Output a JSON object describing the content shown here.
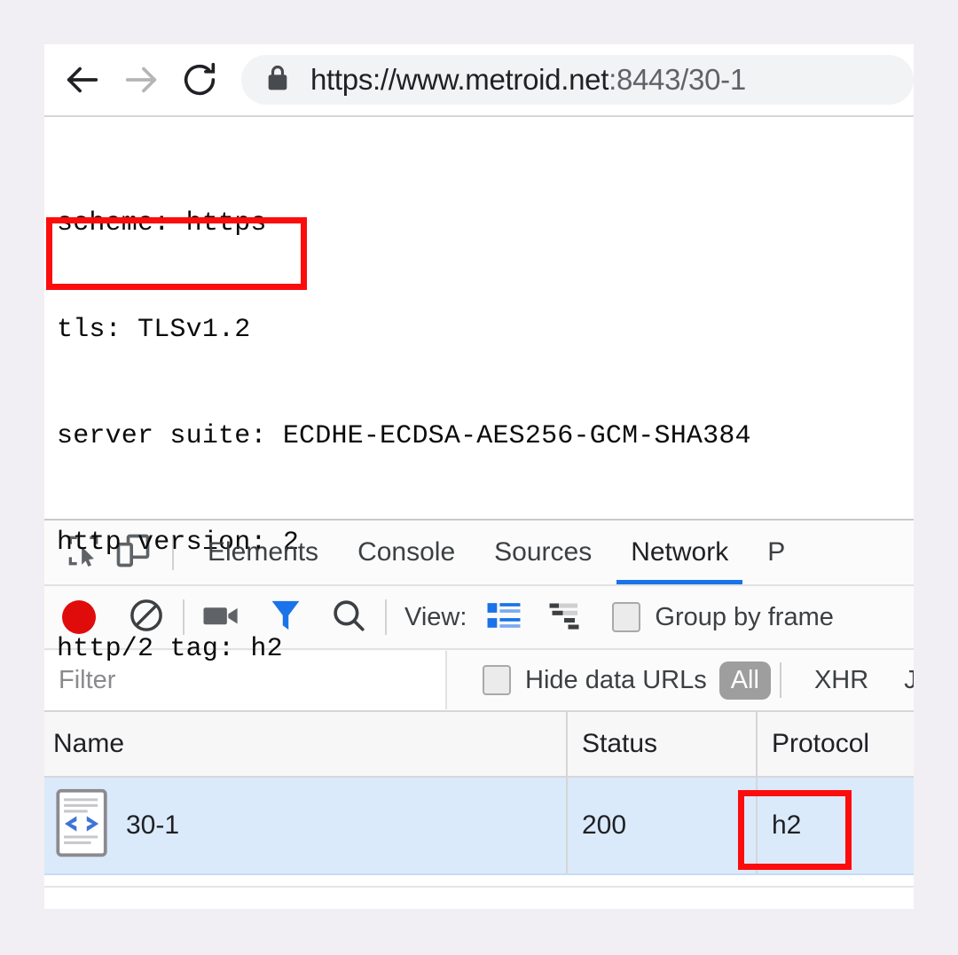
{
  "browser": {
    "nav": {
      "back_icon": "arrow-left-icon",
      "forward_icon": "arrow-right-icon",
      "reload_icon": "reload-icon"
    },
    "omnibox": {
      "lock_icon": "lock-icon",
      "url_host": "https://www.metroid.net",
      "url_tail": ":8443/30-1",
      "full_url": "https://www.metroid.net:8443/30-1"
    }
  },
  "page_content": {
    "lines": [
      "scheme: https",
      "tls: TLSv1.2",
      "server suite: ECDHE-ECDSA-AES256-GCM-SHA384",
      "http version: 2",
      "http/2 tag: h2"
    ]
  },
  "annotations": {
    "color": "#fc0d0d",
    "page_highlight": "http version / http/2 tag lines",
    "protocol_highlight": "h2 protocol cell"
  },
  "devtools": {
    "icons": {
      "inspect": "inspect-element-icon",
      "device": "device-toolbar-icon"
    },
    "tabs": [
      {
        "label": "Elements",
        "active": false
      },
      {
        "label": "Console",
        "active": false
      },
      {
        "label": "Sources",
        "active": false
      },
      {
        "label": "Network",
        "active": true
      },
      {
        "label": "P",
        "active": false
      }
    ],
    "accent_color": "#1a73e8",
    "network_toolbar": {
      "record_icon": "record-circle-icon",
      "record_color": "#e00b0b",
      "clear_icon": "clear-circle-slash-icon",
      "screenshot_icon": "camera-icon",
      "filter_icon": "filter-funnel-icon",
      "filter_icon_color": "#1a73e8",
      "search_icon": "search-icon",
      "view_label": "View:",
      "list_view_icon": "list-view-icon",
      "list_view_color": "#1a73e8",
      "waterfall_icon": "waterfall-view-icon",
      "group_by_frame_checkbox": "group-by-frame-checkbox",
      "group_by_frame_label": "Group by frame"
    },
    "filter_bar": {
      "filter_placeholder": "Filter",
      "filter_value": "",
      "hide_data_urls_label": "Hide data URLs",
      "hide_data_urls_checked": false,
      "type_filters": [
        {
          "label": "All",
          "active": true
        },
        {
          "label": "XHR",
          "active": false
        },
        {
          "label": "JS",
          "active": false
        }
      ]
    },
    "request_table": {
      "columns": [
        "Name",
        "Status",
        "Protocol"
      ],
      "rows": [
        {
          "icon": "document-code-icon",
          "name": "30-1",
          "status": "200",
          "protocol": "h2",
          "selected": true
        }
      ]
    }
  }
}
